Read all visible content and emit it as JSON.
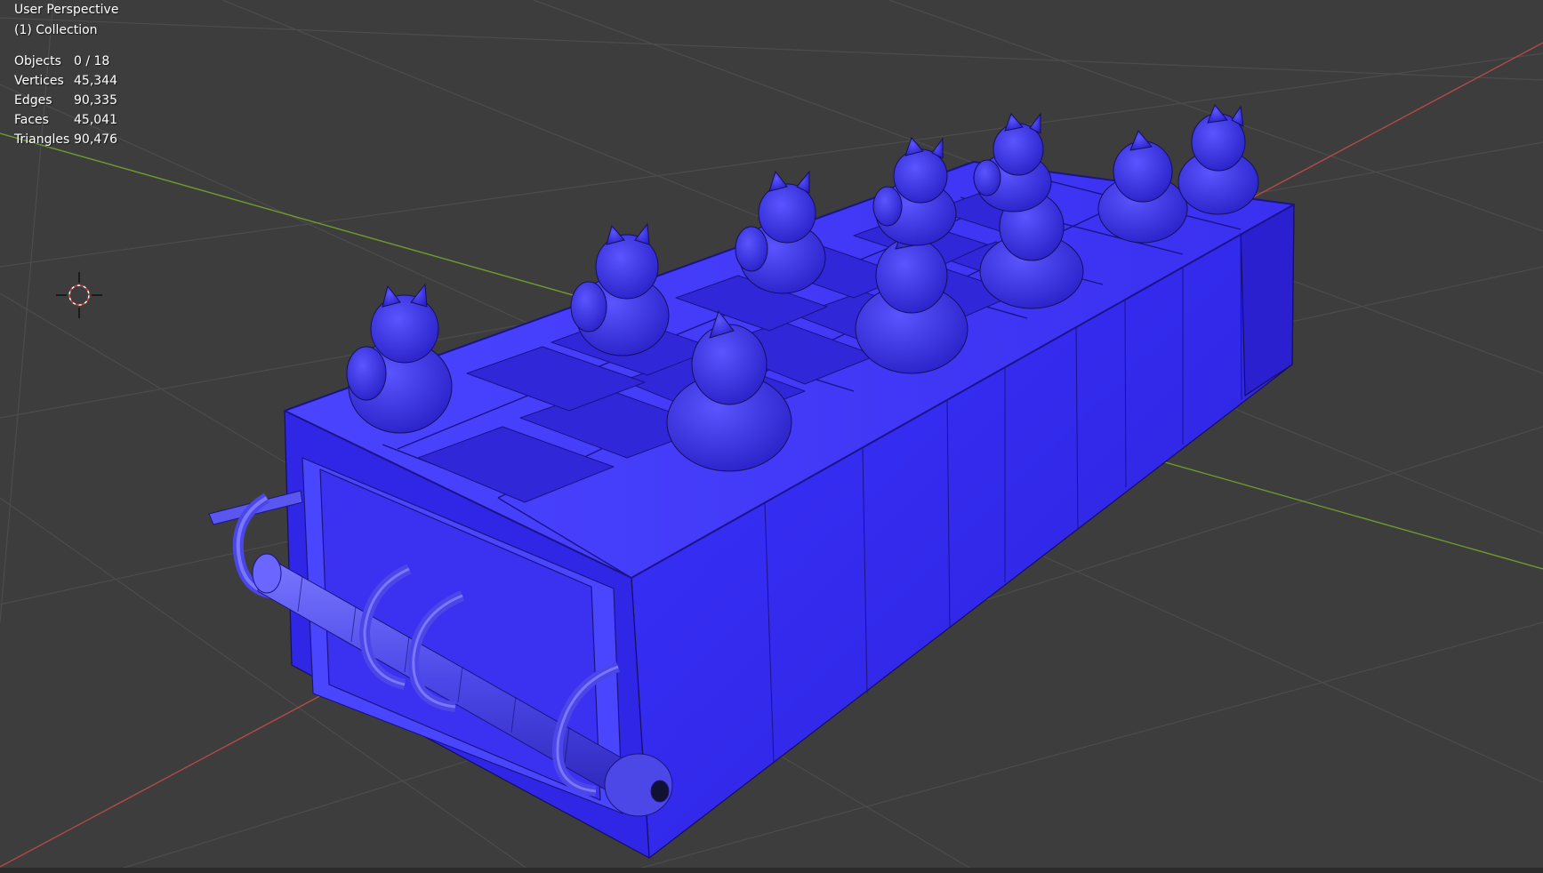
{
  "viewport": {
    "view_name": "User Perspective",
    "collection": "(1) Collection",
    "stats": [
      {
        "label": "Objects",
        "value": "0 / 18"
      },
      {
        "label": "Vertices",
        "value": "45,344"
      },
      {
        "label": "Edges",
        "value": "90,335"
      },
      {
        "label": "Faces",
        "value": "45,041"
      },
      {
        "label": "Triangles",
        "value": "90,476"
      }
    ]
  },
  "scene": {
    "objects": [
      "game-board",
      "cat-figurine",
      "scroll-tube",
      "grid-floor",
      "3d-cursor"
    ],
    "colors": {
      "background": "#3d3d3d",
      "grid": "#4a4a4a",
      "x_axis": "#c0504d",
      "y_axis": "#6f9a2c",
      "mesh": "#3a2ee0",
      "mesh_dark": "#1e17a8",
      "wire": "#111133"
    }
  }
}
